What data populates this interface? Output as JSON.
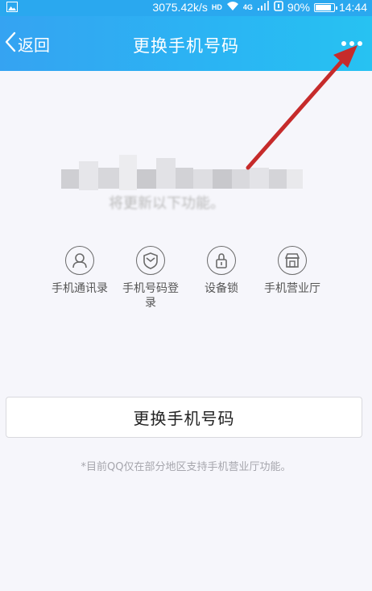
{
  "status_bar": {
    "speed": "3075.42k/s",
    "hd": "HD",
    "net": "4G",
    "battery": "90%",
    "time": "14:44"
  },
  "nav": {
    "back_label": "返回",
    "title": "更换手机号码"
  },
  "info": {
    "description": "将更新以下功能。"
  },
  "features": [
    {
      "label": "手机通讯录",
      "icon": "contact-icon"
    },
    {
      "label": "手机号码登\n录",
      "icon": "shield-icon"
    },
    {
      "label": "设备锁",
      "icon": "lock-icon"
    },
    {
      "label": "手机营业厅",
      "icon": "store-icon"
    }
  ],
  "main": {
    "button_label": "更换手机号码",
    "note": "*目前QQ仅在部分地区支持手机营业厅功能。"
  },
  "colors": {
    "nav_start": "#35a3f2",
    "nav_end": "#27c2f2",
    "annotation_arrow": "#c62b2b"
  }
}
